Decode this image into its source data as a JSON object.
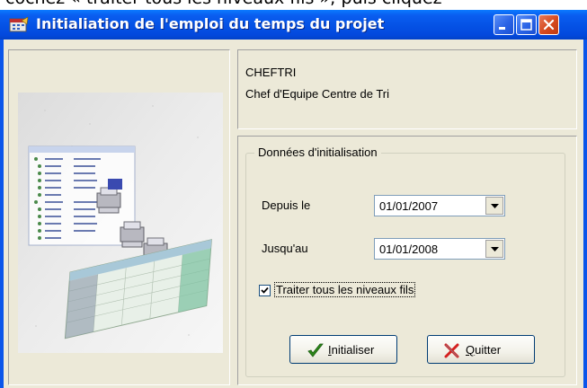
{
  "background_text": "cochez « traiter tous les niveaux fils »; puis cliquez",
  "window": {
    "title": "Initialiation de l'emploi du temps du projet",
    "title_color": "#0a55ea",
    "controls": {
      "minimize_icon": "minimize-icon",
      "maximize_icon": "maximize-icon",
      "close_icon": "close-icon"
    }
  },
  "info": {
    "code": "CHEFTRI",
    "description": "Chef d'Equipe Centre de Tri"
  },
  "group": {
    "legend": "Données d'initialisation",
    "from_label": "Depuis le",
    "from_value": "01/01/2007",
    "to_label": "Jusqu'au",
    "to_value": "01/01/2008",
    "checkbox_label": "Traiter tous les niveaux fils",
    "checkbox_checked": true
  },
  "buttons": {
    "initialize_access": "I",
    "initialize_rest": "nitialiser",
    "quit_access": "Q",
    "quit_rest": "uitter"
  },
  "colors": {
    "accent_check": "#2d8a1a",
    "accent_cross": "#d42020"
  }
}
